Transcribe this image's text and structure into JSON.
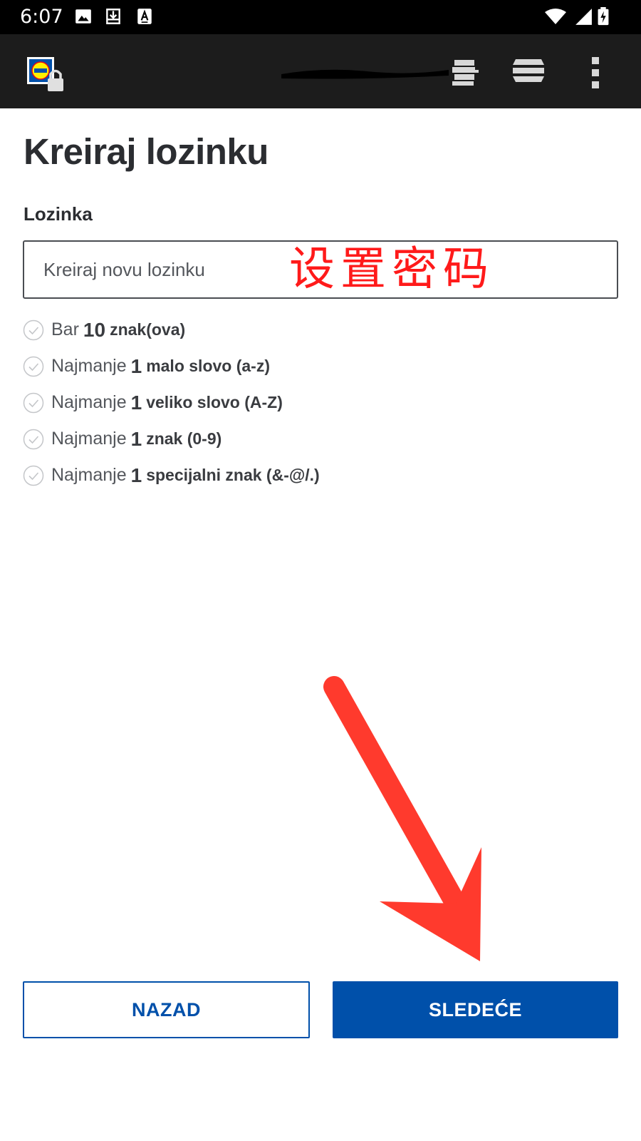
{
  "status_bar": {
    "time": "6:07",
    "icons": [
      "image-icon",
      "download-icon",
      "font-icon",
      "wifi-icon",
      "signal-icon",
      "battery-charging-icon"
    ]
  },
  "toolbar": {
    "logo": "lidl-logo-lock-icon",
    "icons": [
      "translate-icon",
      "list-icon",
      "more-vert-icon"
    ]
  },
  "page": {
    "title": "Kreiraj lozinku",
    "password_label": "Lozinka",
    "password_placeholder": "Kreiraj novu lozinku",
    "password_value": ""
  },
  "annotation": {
    "text": "设置密码",
    "color": "#ff1a1a"
  },
  "rules": [
    {
      "prefix": "Bar",
      "number": "10",
      "desc": "znak(ova)"
    },
    {
      "prefix": "Najmanje",
      "number": "1",
      "desc": "malo slovo (a-z)"
    },
    {
      "prefix": "Najmanje",
      "number": "1",
      "desc": "veliko slovo (A-Z)"
    },
    {
      "prefix": "Najmanje",
      "number": "1",
      "desc": "znak (0-9)"
    },
    {
      "prefix": "Najmanje",
      "number": "1",
      "desc": "specijalni znak (&-@/.)"
    }
  ],
  "buttons": {
    "back": "NAZAD",
    "next": "SLEDEĆE"
  },
  "colors": {
    "brand_blue": "#0050aa",
    "toolbar": "#1c1c1c",
    "status_bar": "#000000"
  }
}
